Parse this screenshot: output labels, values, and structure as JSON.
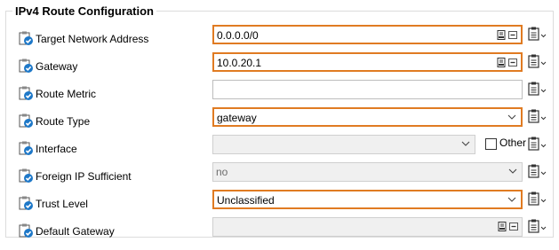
{
  "group_title": "IPv4 Route Configuration",
  "fields": [
    {
      "label": "Target Network Address",
      "value": "0.0.0.0/0",
      "type": "text",
      "highlight": true,
      "disabled": false,
      "buttons": [
        "book-icon",
        "minus-icon"
      ]
    },
    {
      "label": "Gateway",
      "value": "10.0.20.1",
      "type": "text",
      "highlight": true,
      "disabled": false,
      "buttons": [
        "book-icon",
        "minus-icon"
      ]
    },
    {
      "label": "Route Metric",
      "value": "",
      "type": "text",
      "highlight": false,
      "disabled": false,
      "buttons": []
    },
    {
      "label": "Route Type",
      "value": "gateway",
      "type": "select",
      "highlight": true,
      "disabled": false
    },
    {
      "label": "Interface",
      "value": "",
      "type": "select",
      "highlight": false,
      "disabled": true
    },
    {
      "label": "Foreign IP Sufficient",
      "value": "no",
      "type": "select",
      "highlight": false,
      "disabled": true
    },
    {
      "label": "Trust Level",
      "value": "Unclassified",
      "type": "select",
      "highlight": true,
      "disabled": false
    },
    {
      "label": "Default Gateway",
      "value": "",
      "type": "text",
      "highlight": false,
      "disabled": true,
      "buttons": [
        "book-icon",
        "minus-icon"
      ]
    }
  ],
  "other_label": "Other",
  "colors": {
    "highlight": "#e07b22",
    "icon_blue": "#1e78c8"
  },
  "icons": {
    "row": "clipboard-check-icon",
    "side": "clipboard-menu-icon"
  }
}
